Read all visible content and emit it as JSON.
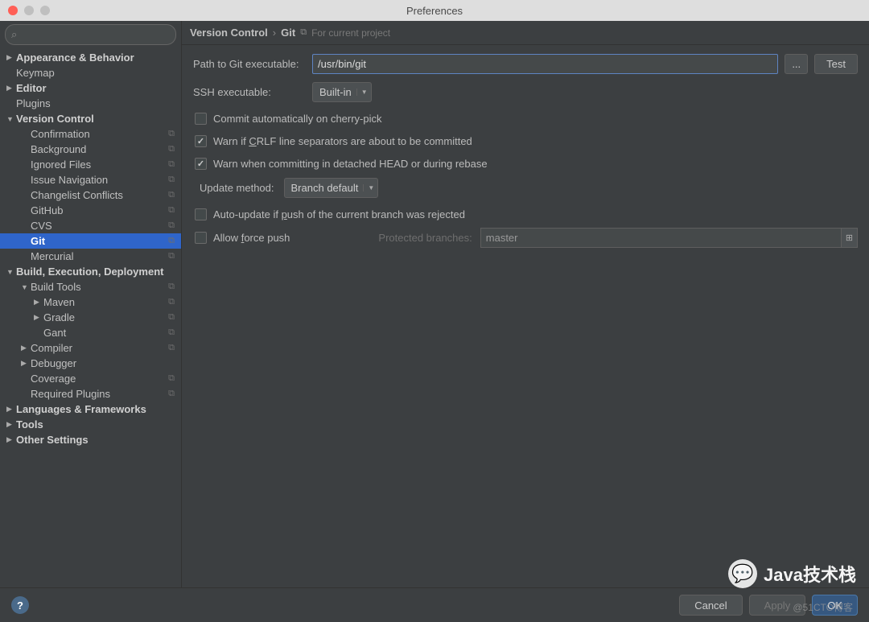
{
  "window": {
    "title": "Preferences"
  },
  "search": {
    "placeholder": ""
  },
  "sidebar": {
    "items": [
      {
        "label": "Appearance & Behavior",
        "arrow": "▶",
        "header": true,
        "indent": 0
      },
      {
        "label": "Keymap",
        "arrow": "",
        "indent": 0
      },
      {
        "label": "Editor",
        "arrow": "▶",
        "header": true,
        "indent": 0
      },
      {
        "label": "Plugins",
        "arrow": "",
        "indent": 0
      },
      {
        "label": "Version Control",
        "arrow": "▼",
        "header": true,
        "indent": 0
      },
      {
        "label": "Confirmation",
        "arrow": "",
        "indent": 1,
        "copy": true
      },
      {
        "label": "Background",
        "arrow": "",
        "indent": 1,
        "copy": true
      },
      {
        "label": "Ignored Files",
        "arrow": "",
        "indent": 1,
        "copy": true
      },
      {
        "label": "Issue Navigation",
        "arrow": "",
        "indent": 1,
        "copy": true
      },
      {
        "label": "Changelist Conflicts",
        "arrow": "",
        "indent": 1,
        "copy": true
      },
      {
        "label": "GitHub",
        "arrow": "",
        "indent": 1,
        "copy": true
      },
      {
        "label": "CVS",
        "arrow": "",
        "indent": 1,
        "copy": true
      },
      {
        "label": "Git",
        "arrow": "",
        "indent": 1,
        "copy": true,
        "selected": true
      },
      {
        "label": "Mercurial",
        "arrow": "",
        "indent": 1,
        "copy": true
      },
      {
        "label": "Build, Execution, Deployment",
        "arrow": "▼",
        "header": true,
        "indent": 0
      },
      {
        "label": "Build Tools",
        "arrow": "▼",
        "indent": 1,
        "copy": true
      },
      {
        "label": "Maven",
        "arrow": "▶",
        "indent": 2,
        "copy": true
      },
      {
        "label": "Gradle",
        "arrow": "▶",
        "indent": 2,
        "copy": true
      },
      {
        "label": "Gant",
        "arrow": "",
        "indent": 2,
        "copy": true
      },
      {
        "label": "Compiler",
        "arrow": "▶",
        "indent": 1,
        "copy": true
      },
      {
        "label": "Debugger",
        "arrow": "▶",
        "indent": 1
      },
      {
        "label": "Coverage",
        "arrow": "",
        "indent": 1,
        "copy": true
      },
      {
        "label": "Required Plugins",
        "arrow": "",
        "indent": 1,
        "copy": true
      },
      {
        "label": "Languages & Frameworks",
        "arrow": "▶",
        "header": true,
        "indent": 0
      },
      {
        "label": "Tools",
        "arrow": "▶",
        "header": true,
        "indent": 0
      },
      {
        "label": "Other Settings",
        "arrow": "▶",
        "header": true,
        "indent": 0
      }
    ]
  },
  "breadcrumb": {
    "parent": "Version Control",
    "current": "Git",
    "hint": "For current project"
  },
  "git": {
    "path_label": "Path to Git executable:",
    "path_value": "/usr/bin/git",
    "browse": "...",
    "test": "Test",
    "ssh_label": "SSH executable:",
    "ssh_value": "Built-in",
    "commit_cherry": "Commit automatically on cherry-pick",
    "warn_crlf": "Warn if CRLF line separators are about to be committed",
    "warn_detached": "Warn when committing in detached HEAD or during rebase",
    "update_label": "Update method:",
    "update_value": "Branch default",
    "auto_update": "Auto-update if push of the current branch was rejected",
    "force_push": "Allow force push",
    "protected_label": "Protected branches:",
    "protected_value": "master"
  },
  "footer": {
    "help": "?",
    "cancel": "Cancel",
    "apply": "Apply",
    "ok": "OK"
  },
  "watermark": {
    "text": "Java技术栈",
    "sub": "@51CTO博客"
  }
}
